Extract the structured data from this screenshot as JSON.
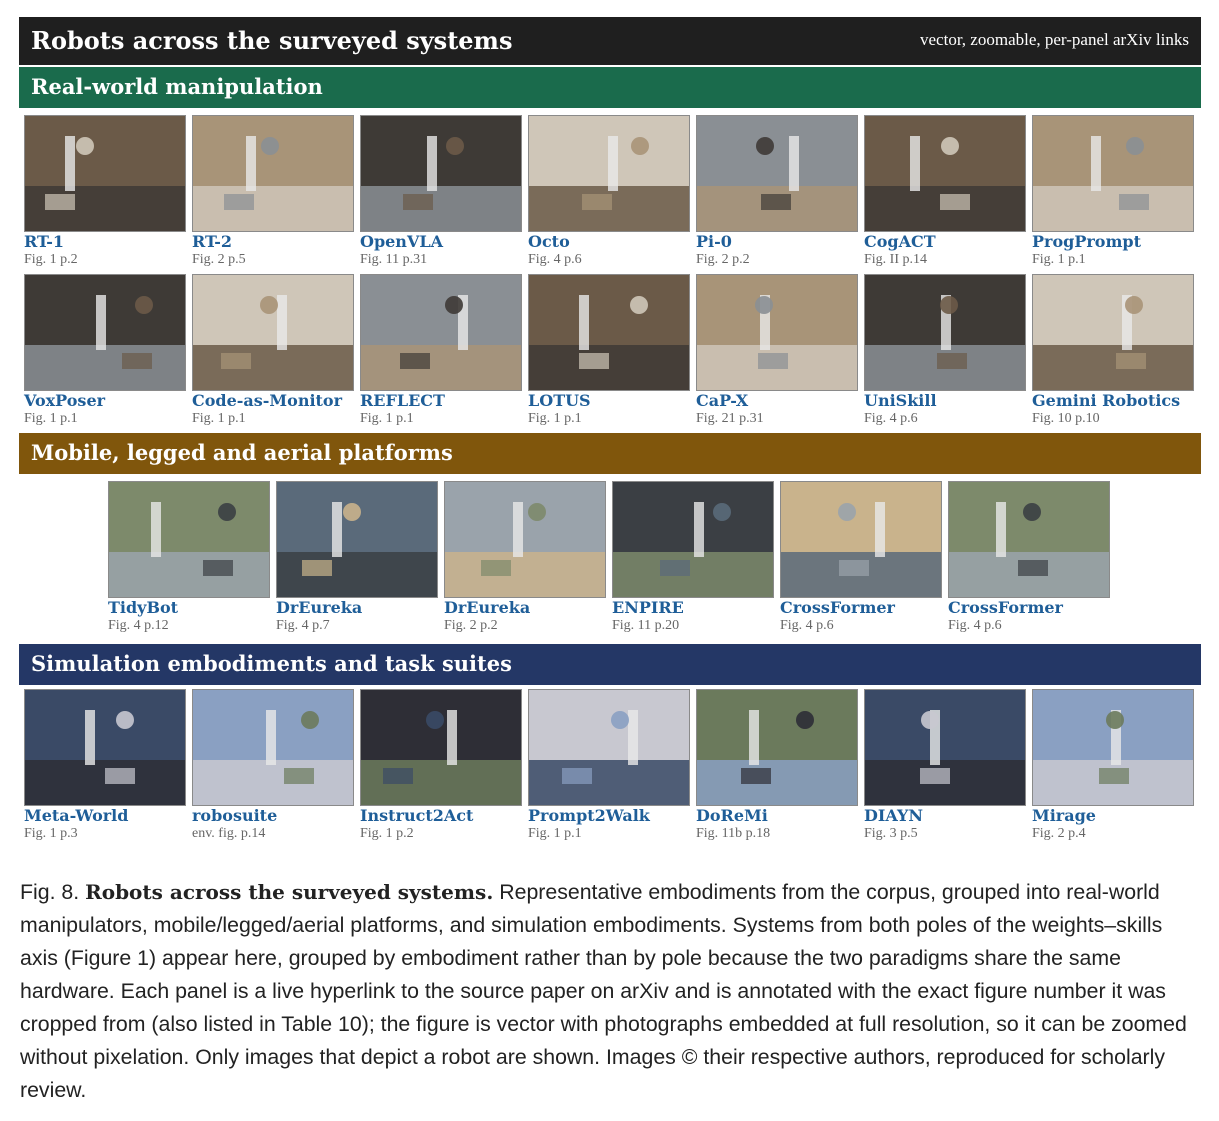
{
  "header": {
    "title": "Robots across the surveyed systems",
    "subtitle": "vector, zoomable, per-panel arXiv links"
  },
  "sections": [
    {
      "title": "Real-world manipulation",
      "color": "#1a6b4c"
    },
    {
      "title": "Mobile, legged and aerial platforms",
      "color": "#80560c"
    },
    {
      "title": "Simulation embodiments and task suites",
      "color": "#243766"
    }
  ],
  "panels": [
    {
      "name": "RT-1",
      "fig": "Fig. 1 p.2",
      "section": 0,
      "icon": "robot-photo-icon"
    },
    {
      "name": "RT-2",
      "fig": "Fig. 2 p.5",
      "section": 0,
      "icon": "robot-photo-icon"
    },
    {
      "name": "OpenVLA",
      "fig": "Fig. 11 p.31",
      "section": 0,
      "icon": "robot-photo-icon"
    },
    {
      "name": "Octo",
      "fig": "Fig. 4 p.6",
      "section": 0,
      "icon": "robot-photo-icon"
    },
    {
      "name": "Pi-0",
      "fig": "Fig. 2 p.2",
      "section": 0,
      "icon": "robot-photo-icon"
    },
    {
      "name": "CogACT",
      "fig": "Fig. II p.14",
      "section": 0,
      "icon": "robot-photo-icon"
    },
    {
      "name": "ProgPrompt",
      "fig": "Fig. 1 p.1",
      "section": 0,
      "icon": "robot-photo-icon"
    },
    {
      "name": "VoxPoser",
      "fig": "Fig. 1 p.1",
      "section": 0,
      "icon": "robot-photo-icon"
    },
    {
      "name": "Code-as-Monitor",
      "fig": "Fig. 1 p.1",
      "section": 0,
      "icon": "robot-photo-icon"
    },
    {
      "name": "REFLECT",
      "fig": "Fig. 1 p.1",
      "section": 0,
      "icon": "robot-photo-icon"
    },
    {
      "name": "LOTUS",
      "fig": "Fig. 1 p.1",
      "section": 0,
      "icon": "robot-photo-icon"
    },
    {
      "name": "CaP-X",
      "fig": "Fig. 21 p.31",
      "section": 0,
      "icon": "robot-photo-icon"
    },
    {
      "name": "UniSkill",
      "fig": "Fig. 4 p.6",
      "section": 0,
      "icon": "robot-photo-icon"
    },
    {
      "name": "Gemini Robotics",
      "fig": "Fig. 10 p.10",
      "section": 0,
      "icon": "robot-photo-icon"
    },
    {
      "name": "TidyBot",
      "fig": "Fig. 4 p.12",
      "section": 1,
      "icon": "robot-photo-icon"
    },
    {
      "name": "DrEureka",
      "fig": "Fig. 4 p.7",
      "section": 1,
      "icon": "robot-photo-icon"
    },
    {
      "name": "DrEureka",
      "fig": "Fig. 2 p.2",
      "section": 1,
      "icon": "robot-photo-icon"
    },
    {
      "name": "ENPIRE",
      "fig": "Fig. 11 p.20",
      "section": 1,
      "icon": "robot-photo-icon"
    },
    {
      "name": "CrossFormer",
      "fig": "Fig. 4 p.6",
      "section": 1,
      "icon": "robot-photo-icon"
    },
    {
      "name": "CrossFormer",
      "fig": "Fig. 4 p.6",
      "section": 1,
      "icon": "robot-photo-icon"
    },
    {
      "name": "Meta-World",
      "fig": "Fig. 1 p.3",
      "section": 2,
      "icon": "simulation-render-icon"
    },
    {
      "name": "robosuite",
      "fig": "env. fig. p.14",
      "section": 2,
      "icon": "simulation-render-icon"
    },
    {
      "name": "Instruct2Act",
      "fig": "Fig. 1 p.2",
      "section": 2,
      "icon": "simulation-render-icon"
    },
    {
      "name": "Prompt2Walk",
      "fig": "Fig. 1 p.1",
      "section": 2,
      "icon": "simulation-render-icon"
    },
    {
      "name": "DoReMi",
      "fig": "Fig. 11b p.18",
      "section": 2,
      "icon": "simulation-render-icon"
    },
    {
      "name": "DIAYN",
      "fig": "Fig. 3 p.5",
      "section": 2,
      "icon": "simulation-render-icon"
    },
    {
      "name": "Mirage",
      "fig": "Fig. 2 p.4",
      "section": 2,
      "icon": "simulation-render-icon"
    }
  ],
  "caption": {
    "label": "Fig. 8.",
    "bold": "Robots across the surveyed systems.",
    "text": "Representative embodiments from the corpus, grouped into real-world manipulators, mobile/legged/aerial platforms, and simulation embodiments. Systems from both poles of the weights–skills axis (Figure 1) appear here, grouped by embodiment rather than by pole because the two paradigms share the same hardware. Each panel is a live hyperlink to the source paper on arXiv and is annotated with the exact figure number it was cropped from (also listed in Table 10); the figure is vector with photographs embedded at full resolution, so it can be zoomed without pixelation. Only images that depict a robot are shown. Images © their respective authors, reproduced for scholarly review."
  }
}
